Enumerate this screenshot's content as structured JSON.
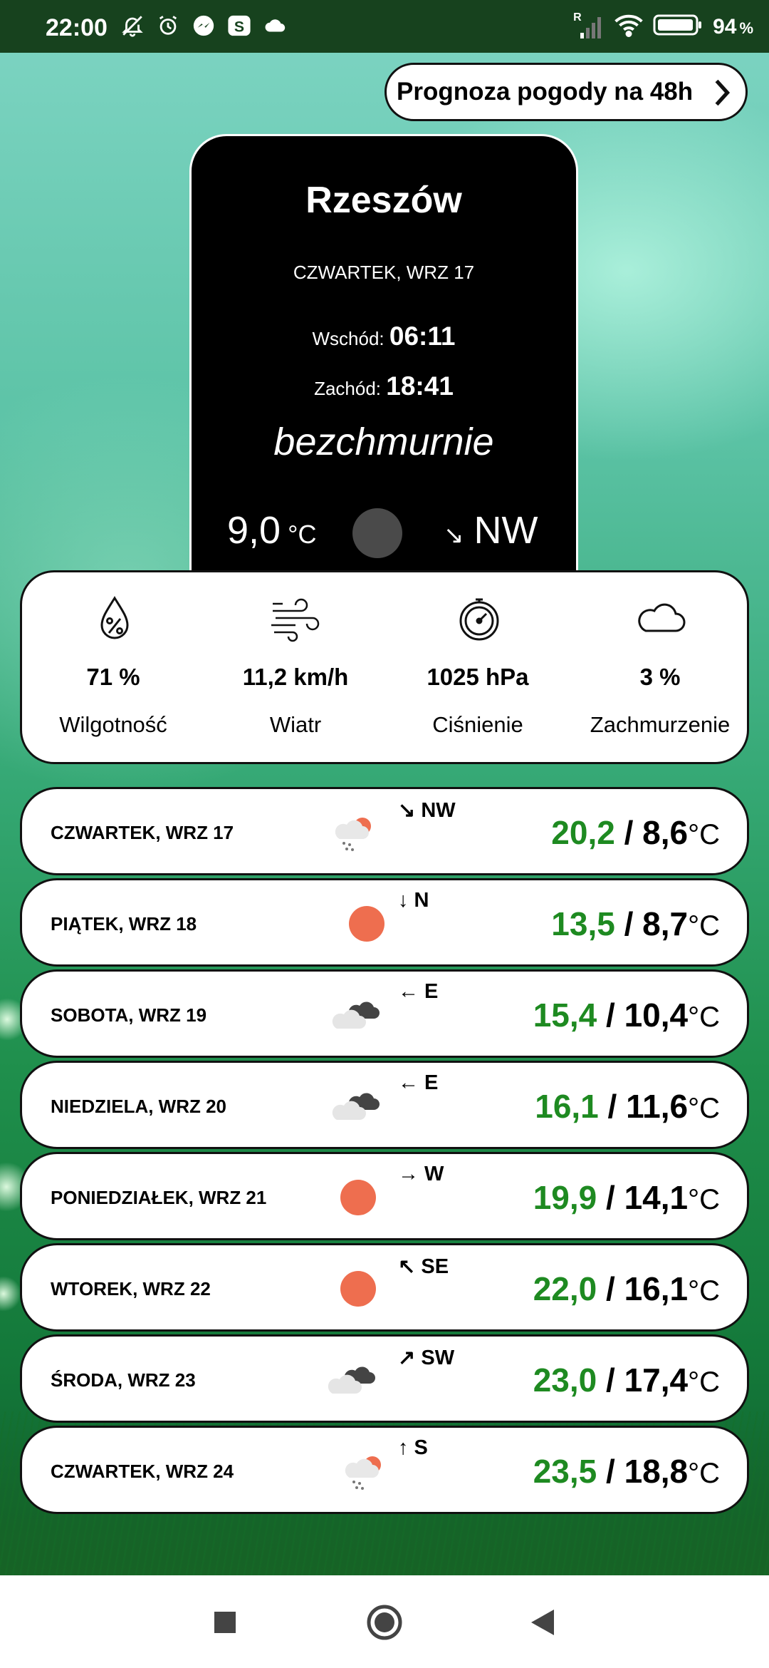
{
  "status_bar": {
    "time": "22:00",
    "icons_left": [
      "muted-bell-icon",
      "alarm-icon",
      "messenger-icon",
      "s-app-icon",
      "cloud-icon"
    ],
    "signal_label": "R",
    "battery_percent": "94",
    "battery_suffix": "%"
  },
  "forecast_button": {
    "label": "Prognoza pogody na 48h"
  },
  "current": {
    "city": "Rzeszów",
    "date": "CZWARTEK, WRZ 17",
    "sunrise_label": "Wschód:",
    "sunrise_time": "06:11",
    "sunset_label": "Zachód:",
    "sunset_time": "18:41",
    "condition": "bezchmurnie",
    "temperature": "9,0",
    "temperature_unit": "°C",
    "wind_arrow": "↘",
    "wind_direction": "NW",
    "icon": "moon-circle-icon"
  },
  "stats": [
    {
      "icon": "humidity-drop-icon",
      "value": "71 %",
      "label": "Wilgotność"
    },
    {
      "icon": "wind-icon",
      "value": "11,2 km/h",
      "label": "Wiatr"
    },
    {
      "icon": "barometer-icon",
      "value": "1025 hPa",
      "label": "Ciśnienie"
    },
    {
      "icon": "cloud-icon",
      "value": "3 %",
      "label": "Zachmurzenie"
    }
  ],
  "days": [
    {
      "day": "CZWARTEK, WRZ 17",
      "icon": "rain-sun-cloud-icon",
      "wind": "↘ NW",
      "high": "20,2",
      "sep": " / ",
      "low": "8,6",
      "unit": "°C"
    },
    {
      "day": "PIĄTEK, WRZ 18",
      "icon": "sun-icon",
      "wind": "↓ N",
      "high": "13,5",
      "sep": " / ",
      "low": "8,7",
      "unit": "°C"
    },
    {
      "day": "SOBOTA, WRZ 19",
      "icon": "clouds-icon",
      "wind": "← E",
      "high": "15,4",
      "sep": " / ",
      "low": "10,4",
      "unit": "°C"
    },
    {
      "day": "NIEDZIELA, WRZ 20",
      "icon": "clouds-icon",
      "wind": "← E",
      "high": "16,1",
      "sep": " / ",
      "low": "11,6",
      "unit": "°C"
    },
    {
      "day": "PONIEDZIAŁEK, WRZ 21",
      "icon": "sun-icon",
      "wind": "→ W",
      "high": "19,9",
      "sep": " / ",
      "low": "14,1",
      "unit": "°C"
    },
    {
      "day": "WTOREK, WRZ 22",
      "icon": "sun-icon",
      "wind": "↖ SE",
      "high": "22,0",
      "sep": " / ",
      "low": "16,1",
      "unit": "°C"
    },
    {
      "day": "ŚRODA, WRZ 23",
      "icon": "clouds-icon",
      "wind": "↗ SW",
      "high": "23,0",
      "sep": " / ",
      "low": "17,4",
      "unit": "°C"
    },
    {
      "day": "CZWARTEK, WRZ 24",
      "icon": "rain-sun-cloud-icon",
      "wind": "↑ S",
      "high": "23,5",
      "sep": " / ",
      "low": "18,8",
      "unit": "°C"
    }
  ],
  "colors": {
    "high_temp": "#1e8a21",
    "sun": "#ee6e4f",
    "status_bar": "#17421e"
  },
  "nav": [
    "recents-square-icon",
    "home-circle-icon",
    "back-triangle-icon"
  ]
}
